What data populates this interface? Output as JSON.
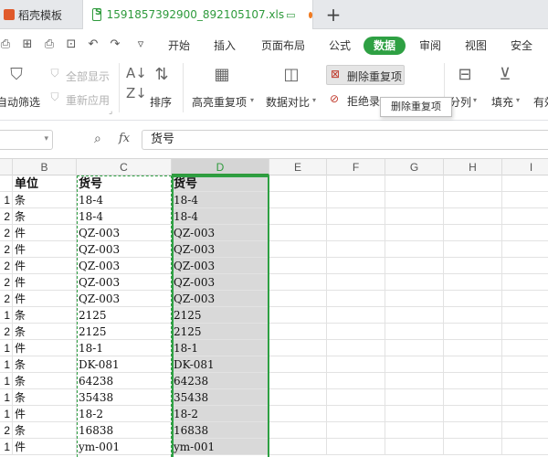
{
  "tabs": {
    "template_label": "稻壳模板",
    "file_label": "1591857392900_892105107.xls",
    "add_label": "+"
  },
  "menu": {
    "items": [
      "开始",
      "插入",
      "页面布局",
      "公式",
      "数据",
      "审阅",
      "视图",
      "安全"
    ],
    "active": "数据"
  },
  "ribbon": {
    "autofilter": "自动筛选",
    "show_all": "全部显示",
    "reapply": "重新应用",
    "sort": "排序",
    "highlight_dup": "高亮重复项",
    "compare": "数据对比",
    "delete_dup": "删除重复项",
    "reject_dup": "拒绝录",
    "split": "分列",
    "fill": "填充",
    "valid": "有效",
    "tooltip": "删除重复项"
  },
  "formula": {
    "content": "货号"
  },
  "columns": [
    "B",
    "C",
    "D",
    "E",
    "F",
    "G",
    "H",
    "I"
  ],
  "rows": [
    {
      "a": "",
      "b": "单位",
      "c": "货号",
      "d": "货号",
      "header": true
    },
    {
      "a": "1",
      "b": "条",
      "c": "18-4",
      "d": "18-4"
    },
    {
      "a": "2",
      "b": "条",
      "c": "18-4",
      "d": "18-4"
    },
    {
      "a": "2",
      "b": "件",
      "c": "QZ-003",
      "d": "QZ-003"
    },
    {
      "a": "2",
      "b": "件",
      "c": "QZ-003",
      "d": "QZ-003"
    },
    {
      "a": "2",
      "b": "件",
      "c": "QZ-003",
      "d": "QZ-003"
    },
    {
      "a": "2",
      "b": "件",
      "c": "QZ-003",
      "d": "QZ-003"
    },
    {
      "a": "2",
      "b": "件",
      "c": "QZ-003",
      "d": "QZ-003"
    },
    {
      "a": "1",
      "b": "条",
      "c": "2125",
      "d": "2125"
    },
    {
      "a": "2",
      "b": "条",
      "c": "2125",
      "d": "2125"
    },
    {
      "a": "1",
      "b": "件",
      "c": "18-1",
      "d": "18-1"
    },
    {
      "a": "1",
      "b": "条",
      "c": "DK-081",
      "d": "DK-081"
    },
    {
      "a": "1",
      "b": "条",
      "c": "64238",
      "d": "64238"
    },
    {
      "a": "1",
      "b": "条",
      "c": "35438",
      "d": "35438"
    },
    {
      "a": "1",
      "b": "件",
      "c": "18-2",
      "d": "18-2"
    },
    {
      "a": "2",
      "b": "条",
      "c": "16838",
      "d": "16838"
    },
    {
      "a": "1",
      "b": "件",
      "c": "ym-001",
      "d": "ym-001"
    }
  ],
  "colors": {
    "accent": "#2ea043",
    "selection_fill": "#d9d9d9",
    "tab_dot": "#f07b22"
  },
  "icons": [
    "filter-icon",
    "sort-asc-icon",
    "sort-desc-icon",
    "highlight-dup-icon",
    "compare-icon",
    "delete-dup-icon",
    "split-icon",
    "fill-icon",
    "zoom-icon",
    "fx-icon"
  ]
}
